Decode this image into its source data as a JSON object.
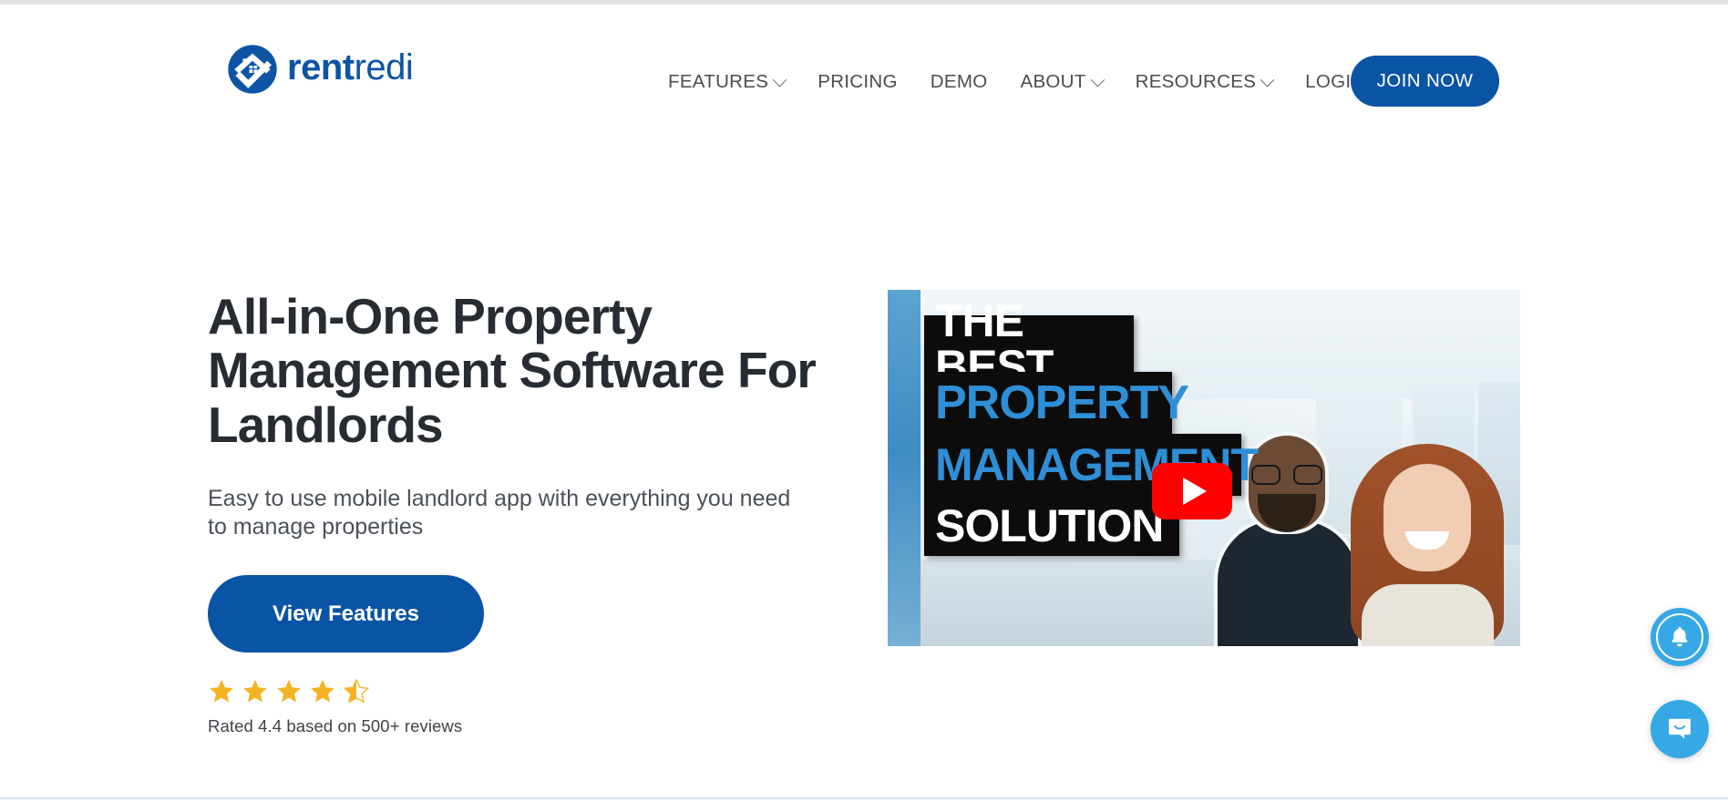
{
  "brand": {
    "logo_icon": "rentredi-house-logo-icon",
    "name_bold": "rent",
    "name_light": "redi",
    "primary_color": "#0a54a6",
    "star_color": "#f5b324",
    "widget_color": "#37a8e6"
  },
  "nav": {
    "items": [
      {
        "label": "FEATURES",
        "has_dropdown": true
      },
      {
        "label": "PRICING",
        "has_dropdown": false
      },
      {
        "label": "DEMO",
        "has_dropdown": false
      },
      {
        "label": "ABOUT",
        "has_dropdown": true
      },
      {
        "label": "RESOURCES",
        "has_dropdown": true
      },
      {
        "label": "LOGIN",
        "has_dropdown": false
      }
    ],
    "cta_label": "JOIN NOW"
  },
  "hero": {
    "title": "All-in-One Property Management Software For Landlords",
    "subtitle": "Easy to use mobile landlord app with everything you need to manage properties",
    "cta_label": "View Features",
    "rating_value": 4.4,
    "rating_stars_full": 4,
    "rating_has_half": true,
    "rating_text": "Rated 4.4 based on 500+ reviews"
  },
  "video": {
    "provider": "YouTube",
    "play_icon": "play-triangle-icon",
    "overlay_lines": [
      {
        "text": "THE BEST",
        "color": "#ffffff"
      },
      {
        "text": "PROPERTY",
        "color": "#2f8fd6"
      },
      {
        "text": "MANAGEMENT",
        "color": "#2f8fd6"
      },
      {
        "text": "SOLUTION",
        "color": "#ffffff"
      }
    ]
  },
  "widgets": {
    "notification_icon": "bell-icon",
    "chat_icon": "chat-bubble-icon"
  }
}
